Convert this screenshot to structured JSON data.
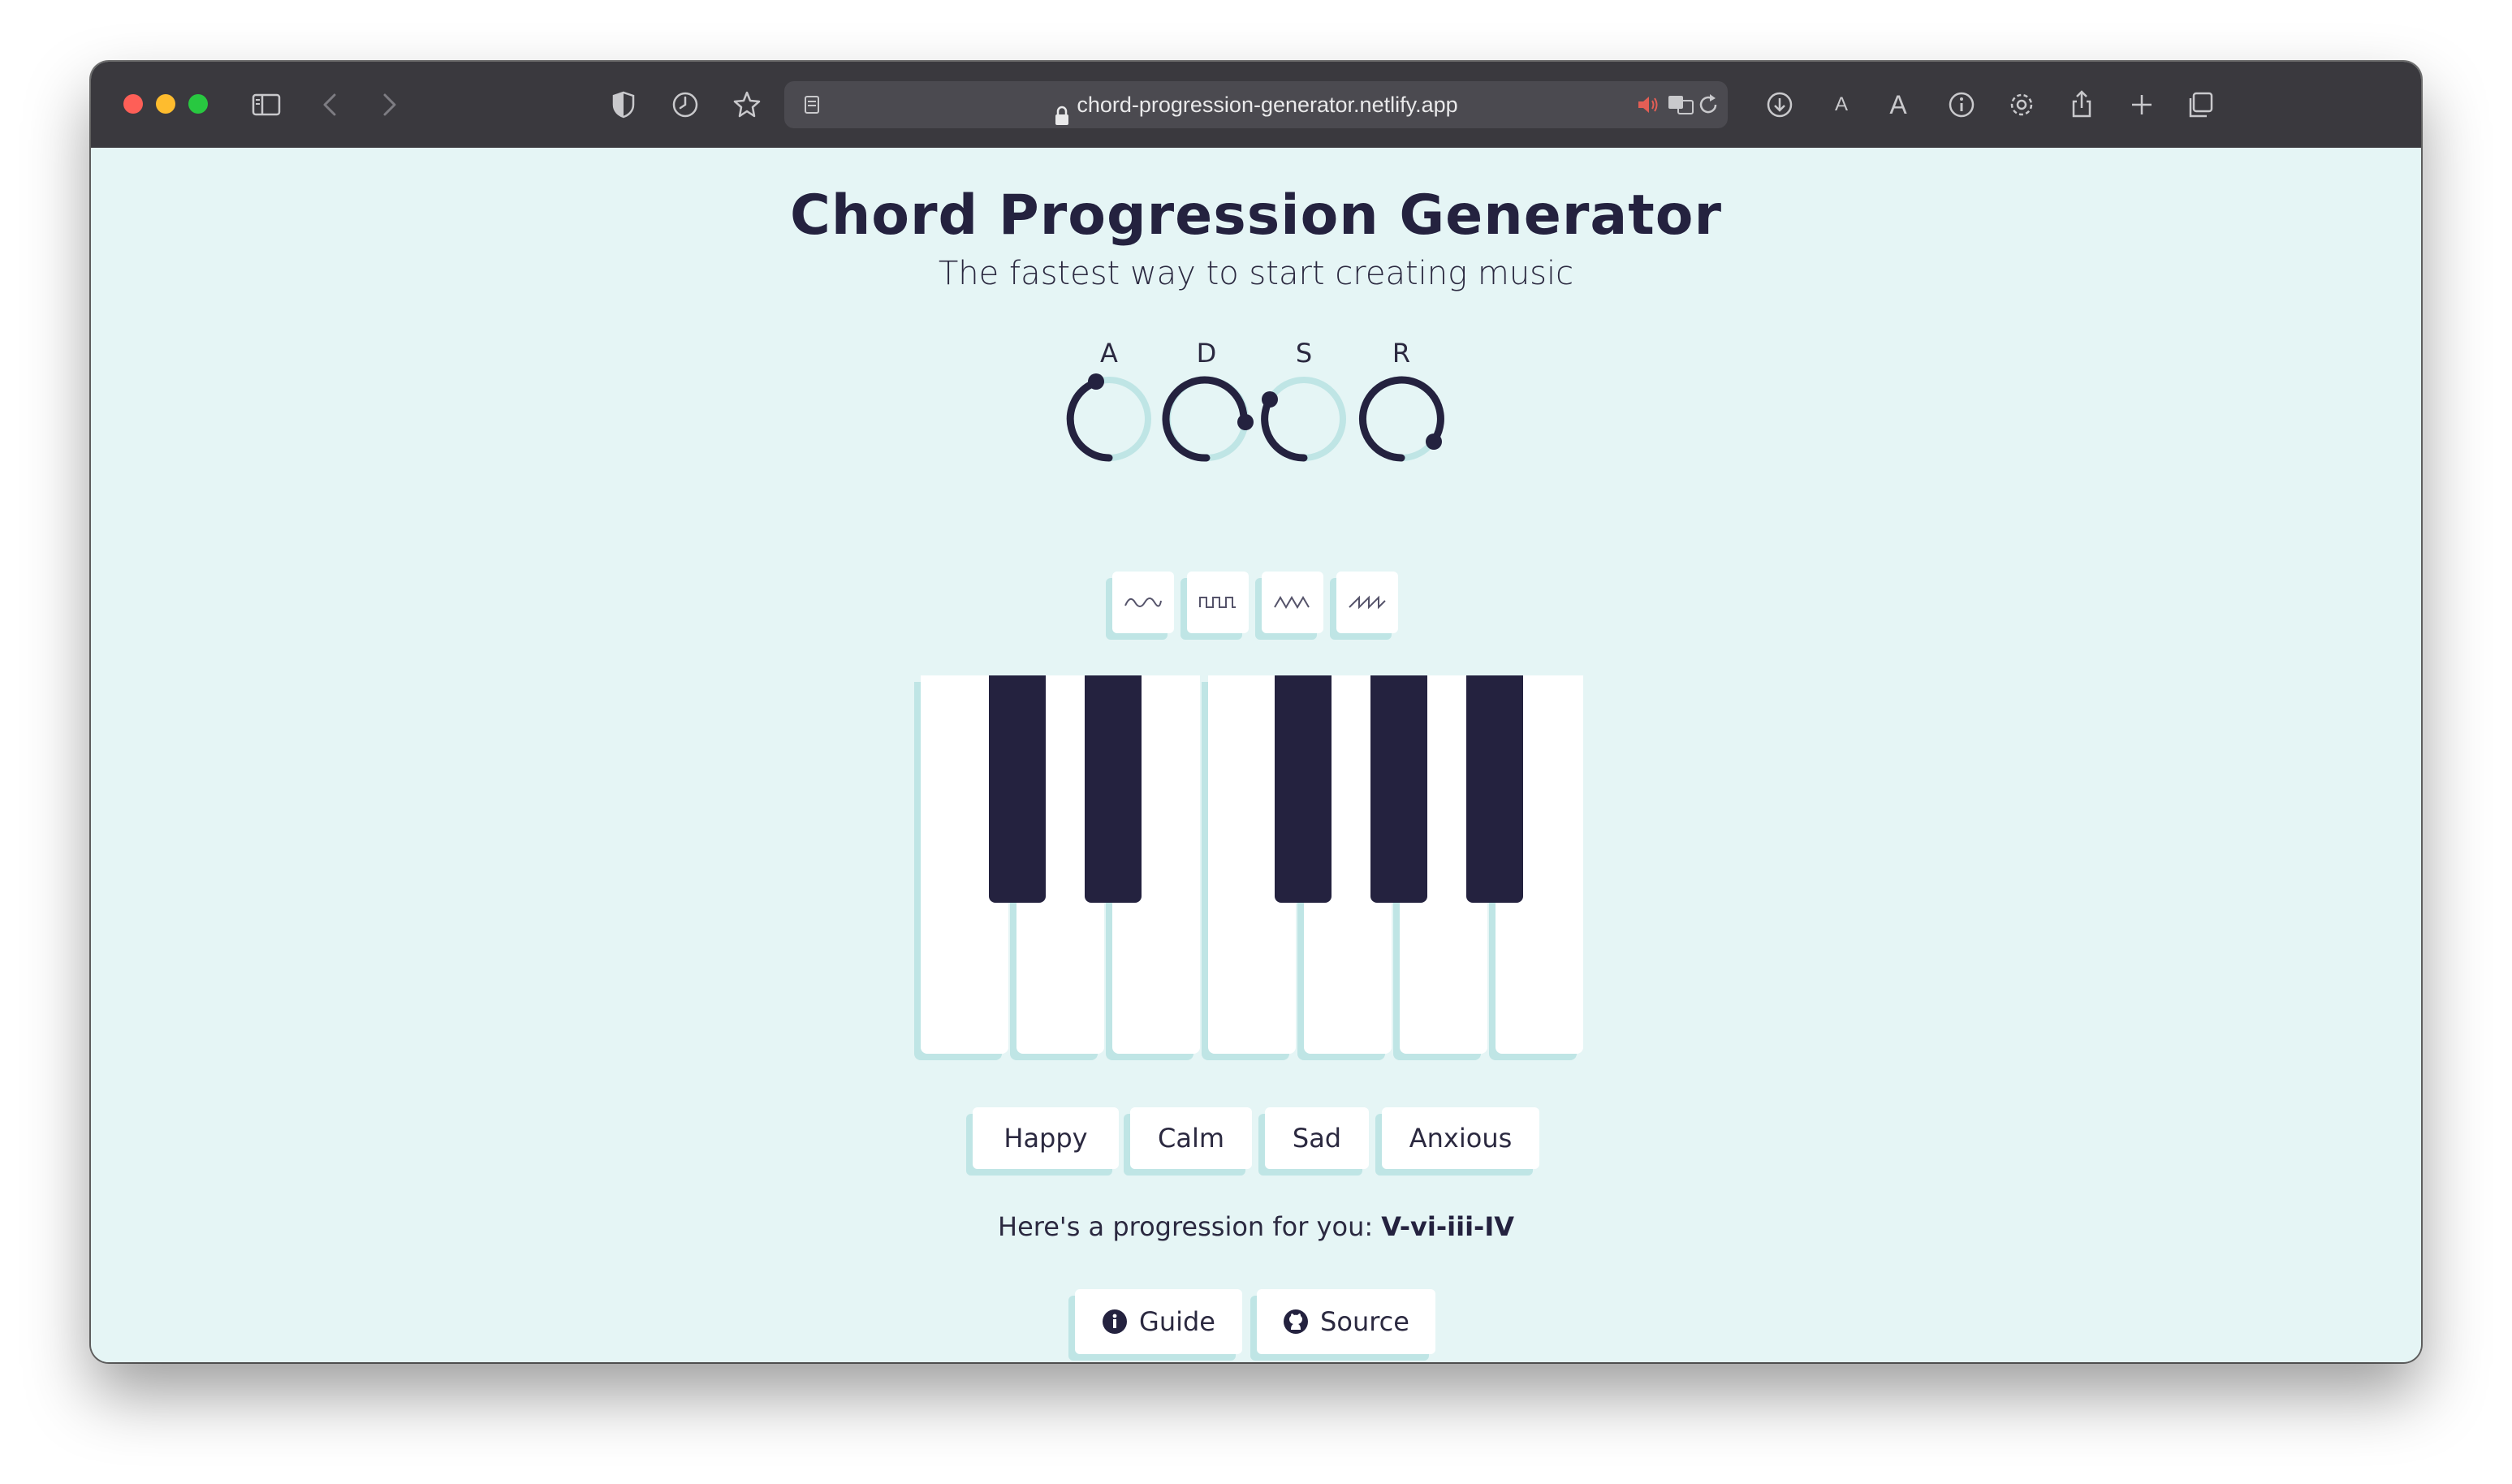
{
  "browser": {
    "url": "chord-progression-generator.netlify.app",
    "icons": [
      "sidebar-icon",
      "back-icon",
      "forward-icon",
      "shield-icon",
      "history-icon",
      "star-icon",
      "reader-icon",
      "lock-icon",
      "mute-icon",
      "translate-icon",
      "reload-icon",
      "download-icon",
      "text-smaller-icon",
      "text-larger-icon",
      "info-icon",
      "gear-icon",
      "share-icon",
      "new-tab-icon",
      "tabs-overview-icon"
    ],
    "text_smaller_label": "A",
    "text_larger_label": "A"
  },
  "header": {
    "title": "Chord Progression Generator",
    "subtitle": "The fastest way to start creating music"
  },
  "envelope": {
    "knobs": [
      {
        "label": "A"
      },
      {
        "label": "D"
      },
      {
        "label": "S"
      },
      {
        "label": "R"
      }
    ]
  },
  "waveforms": [
    "sine-wave-icon",
    "square-wave-icon",
    "triangle-wave-icon",
    "sawtooth-wave-icon"
  ],
  "moods": [
    {
      "label": "Happy"
    },
    {
      "label": "Calm"
    },
    {
      "label": "Sad"
    },
    {
      "label": "Anxious"
    }
  ],
  "progression": {
    "prefix": "Here's a progression for you: ",
    "value": "V-vi-iii-IV"
  },
  "links": {
    "guide": {
      "label": "Guide",
      "icon": "info-circle-icon"
    },
    "source": {
      "label": "Source",
      "icon": "github-icon"
    }
  },
  "colors": {
    "background": "#e5f5f5",
    "dark": "#24223f",
    "accent_shadow": "#bfe5e5",
    "toolbar": "#3a393e"
  }
}
